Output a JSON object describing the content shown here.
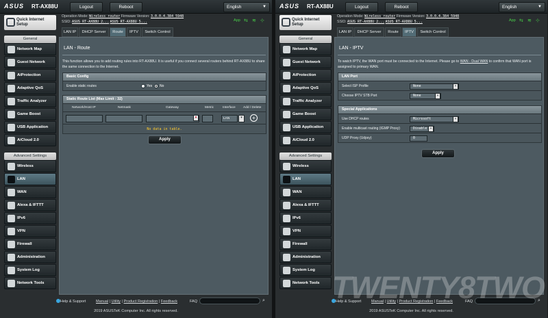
{
  "brand": {
    "logo": "ASUS",
    "model": "RT-AX88U"
  },
  "header": {
    "logout": "Logout",
    "reboot": "Reboot",
    "language": "English"
  },
  "info": {
    "op_label": "Operation Mode:",
    "op_value": "Wireless router",
    "fw_label": "Firmware Version:",
    "fw_value": "3.0.0.4.384_5948",
    "ssid_label": "SSID:",
    "ssid1": "ASUS RT-AX88U 2...",
    "ssid2": "ASUS RT-AX88U 5...",
    "app": "App"
  },
  "sidebar": {
    "quick_setup": "Quick Internet Setup",
    "general_header": "General",
    "general": [
      "Network Map",
      "Guest Network",
      "AiProtection",
      "Adaptive QoS",
      "Traffic Analyzer",
      "Game Boost",
      "USB Application",
      "AiCloud 2.0"
    ],
    "advanced_header": "Advanced Settings",
    "advanced": [
      "Wireless",
      "LAN",
      "WAN",
      "Alexa & IFTTT",
      "IPv6",
      "VPN",
      "Firewall",
      "Administration",
      "System Log",
      "Network Tools"
    ]
  },
  "tabs": [
    "LAN IP",
    "DHCP Server",
    "Route",
    "IPTV",
    "Switch Control"
  ],
  "route": {
    "title": "LAN - Route",
    "desc": "This function allows you to add routing rules into RT-AX88U. It is useful if you connect several routers behind RT-AX88U to share the same connection to the Internet.",
    "basic_header": "Basic Config",
    "enable_label": "Enable static routes",
    "yes": "Yes",
    "no": "No",
    "list_header": "Static Route List (Max Limit : 32)",
    "cols": [
      "Network/Host IP",
      "Netmask",
      "Gateway",
      "Metric",
      "Interface",
      "Add / Delete"
    ],
    "iface_value": "LAN",
    "no_data": "No data in table.",
    "apply": "Apply"
  },
  "iptv": {
    "title": "LAN - IPTV",
    "desc_a": "To watch IPTV, the WAN port must be connected to the Internet. Please go to ",
    "desc_link": "WAN - Dual WAN",
    "desc_b": " to confirm that WAN port is assigned to primary WAN.",
    "lan_port_header": "LAN Port",
    "isp_label": "Select ISP Profile",
    "isp_value": "None",
    "stb_label": "Choose IPTV STB Port",
    "stb_value": "None",
    "special_header": "Special Applications",
    "dhcp_label": "Use DHCP routes",
    "dhcp_value": "Microsoft",
    "igmp_label": "Enable multicast routing (IGMP Proxy)",
    "igmp_value": "Disable",
    "udp_label": "UDP Proxy (Udpxy)",
    "udp_value": "0",
    "apply": "Apply"
  },
  "footer": {
    "help": "Help & Support",
    "manual": "Manual",
    "utility": "Utility",
    "product_reg": "Product Registration",
    "feedback": "Feedback",
    "faq": "FAQ",
    "copyright": "2019 ASUSTeK Computer Inc. All rights reserved."
  },
  "watermark": "TWENTY8TWO"
}
